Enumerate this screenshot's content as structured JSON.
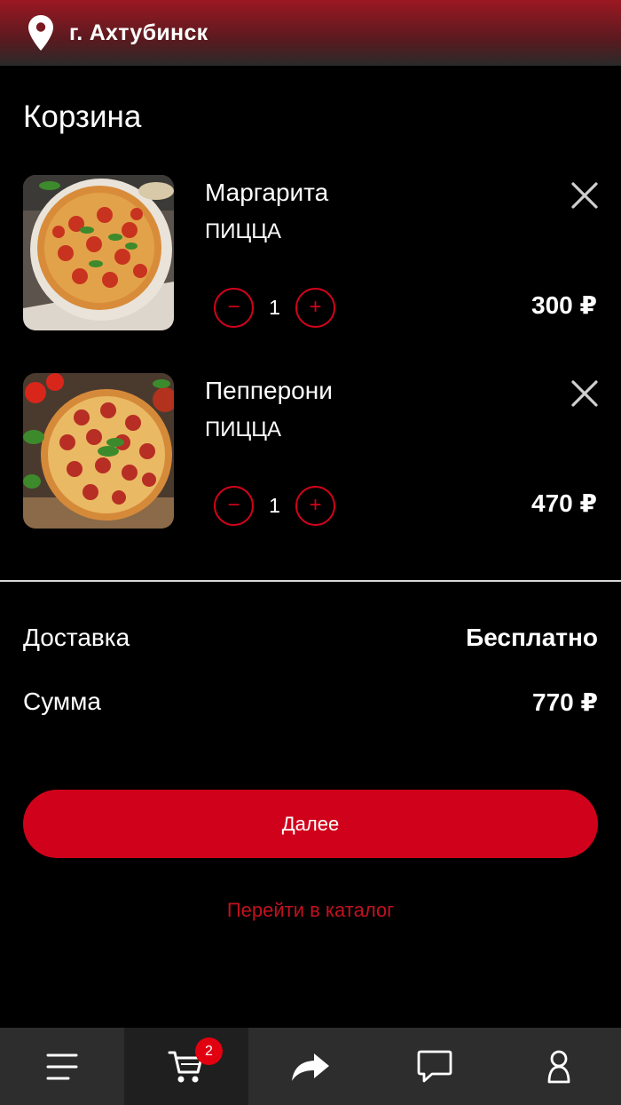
{
  "header": {
    "city": "г. Ахтубинск",
    "icon": "location-pin-icon"
  },
  "cart": {
    "title": "Корзина",
    "items": [
      {
        "name": "Маргарита",
        "category": "ПИЦЦА",
        "qty": "1",
        "price": "300 ₽",
        "image": "margherita-pizza"
      },
      {
        "name": "Пепперони",
        "category": "ПИЦЦА",
        "qty": "1",
        "price": "470 ₽",
        "image": "pepperoni-pizza"
      }
    ],
    "decrement_symbol": "−",
    "increment_symbol": "+"
  },
  "summary": {
    "delivery_label": "Доставка",
    "delivery_value": "Бесплатно",
    "sum_label": "Сумма",
    "sum_value": "770 ₽"
  },
  "actions": {
    "next_label": "Далее",
    "catalog_link": "Перейти в каталог"
  },
  "tabbar": {
    "tabs": [
      {
        "icon": "menu-icon",
        "active": false
      },
      {
        "icon": "cart-icon",
        "active": true,
        "badge": "2"
      },
      {
        "icon": "share-icon",
        "active": false
      },
      {
        "icon": "chat-icon",
        "active": false
      },
      {
        "icon": "profile-icon",
        "active": false
      }
    ]
  },
  "colors": {
    "accent": "#d0021b",
    "background": "#000000",
    "tabbar": "#2d2d2d"
  }
}
